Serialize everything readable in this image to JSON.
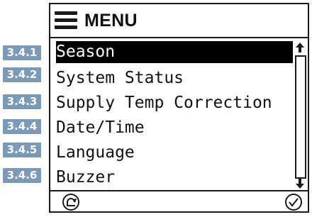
{
  "screen": {
    "title": "MENU",
    "icon": "hamburger-menu-icon"
  },
  "step_labels": [
    "3.4.1",
    "3.4.2",
    "3.4.3",
    "3.4.4",
    "3.4.5",
    "3.4.6"
  ],
  "menu": {
    "selected_index": 0,
    "items": [
      {
        "label": "Season"
      },
      {
        "label": "System Status"
      },
      {
        "label": "Supply Temp Correction"
      },
      {
        "label": "Date/Time"
      },
      {
        "label": "Language"
      },
      {
        "label": "Buzzer"
      }
    ]
  },
  "scrollbar": {
    "up_icon": "arrow-up-icon",
    "down_icon": "arrow-down-icon"
  },
  "footer": {
    "back_icon": "back-icon",
    "confirm_icon": "checkmark-icon"
  },
  "colors": {
    "step_label_bg": "#7a9ab7",
    "selected_row_bg": "#000000",
    "selected_row_text": "#ffffff",
    "frame": "#1a1a1a"
  }
}
